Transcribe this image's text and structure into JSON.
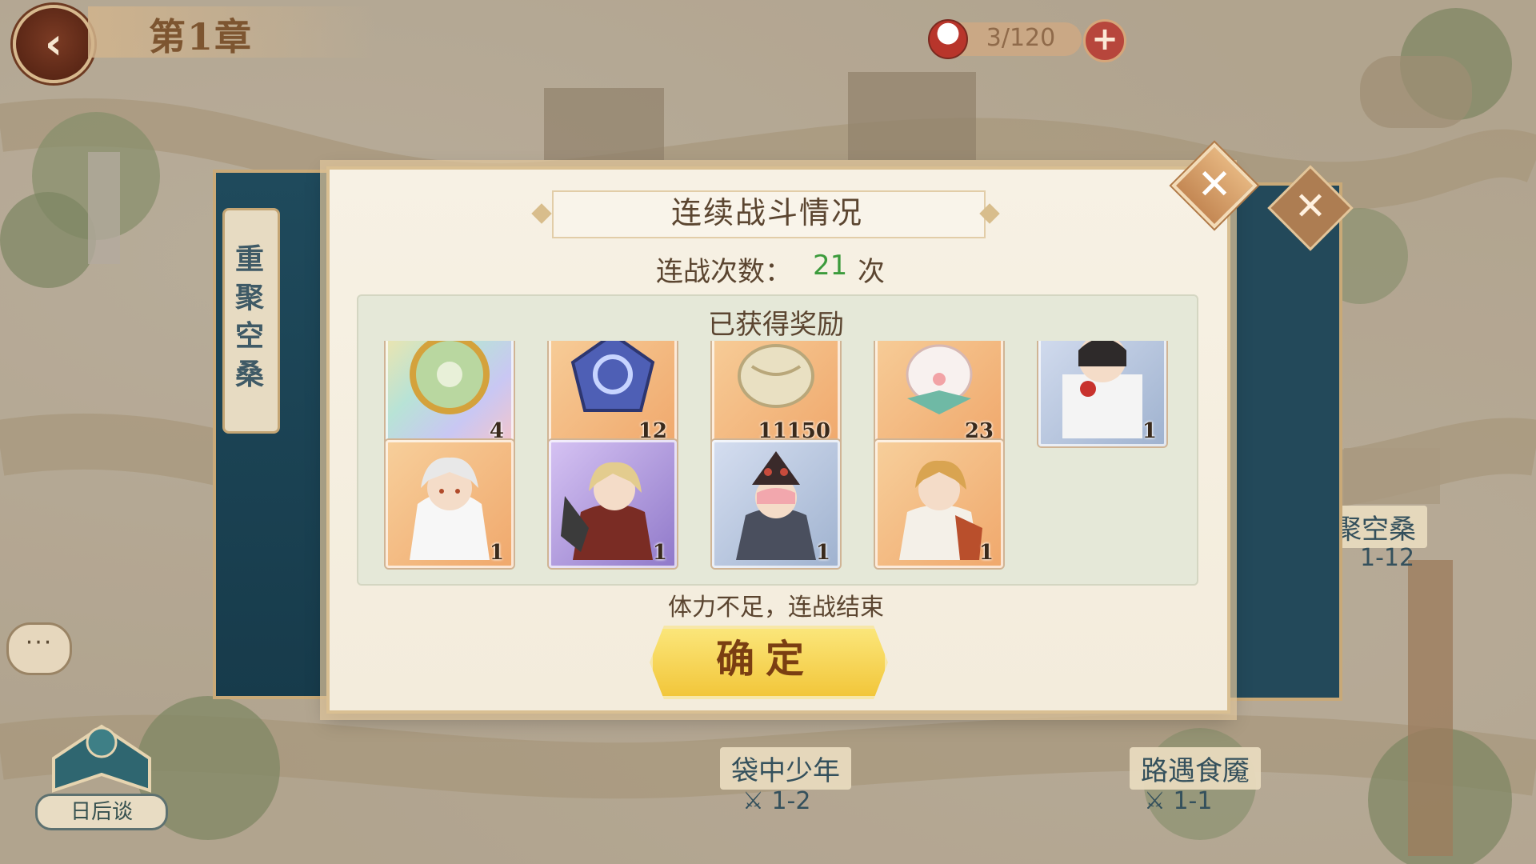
{
  "header": {
    "back_icon": "back-arrow-icon",
    "chapter_title": "第1章",
    "stamina_value": "3/120",
    "plus_label": "+"
  },
  "side_tab": {
    "label": "重聚空桑"
  },
  "map_stages": [
    {
      "title": "袋中少年",
      "sub": "1-2"
    },
    {
      "title": "路遇食魇",
      "sub": "1-1"
    },
    {
      "title": "聚空桑",
      "sub": "1-12"
    }
  ],
  "book": {
    "label": "日后谈"
  },
  "chat": {
    "label": "···"
  },
  "dialog": {
    "title": "连续战斗情况",
    "battle_count_label": "连战次数：",
    "battle_count_value": "21",
    "battle_count_unit": "次",
    "reward_title": "已获得奖励",
    "end_message": "体力不足，连战结束",
    "confirm_label": "确定",
    "close_icon": "close-x-icon"
  },
  "rewards": [
    {
      "name": "jade-ring-item",
      "count": "4",
      "rarity": "rainbow"
    },
    {
      "name": "blue-crystal-item",
      "count": "12",
      "rarity": "orange"
    },
    {
      "name": "dumpling-item",
      "count": "11150",
      "rarity": "orange"
    },
    {
      "name": "mochi-bun-pet-item",
      "count": "23",
      "rarity": "orange"
    },
    {
      "name": "character-card-white-red",
      "count": "1",
      "rarity": "blue"
    },
    {
      "name": "character-card-white-hair",
      "count": "1",
      "rarity": "orange"
    },
    {
      "name": "character-card-blonde-feather",
      "count": "1",
      "rarity": "purple"
    },
    {
      "name": "character-card-pink-hat",
      "count": "1",
      "rarity": "blue"
    },
    {
      "name": "character-card-blonde-smile",
      "count": "1",
      "rarity": "orange"
    }
  ],
  "colors": {
    "accent_green": "#3c9b3c",
    "confirm_yellow": "#f2c63a",
    "panel_teal": "#1f4a5c"
  }
}
